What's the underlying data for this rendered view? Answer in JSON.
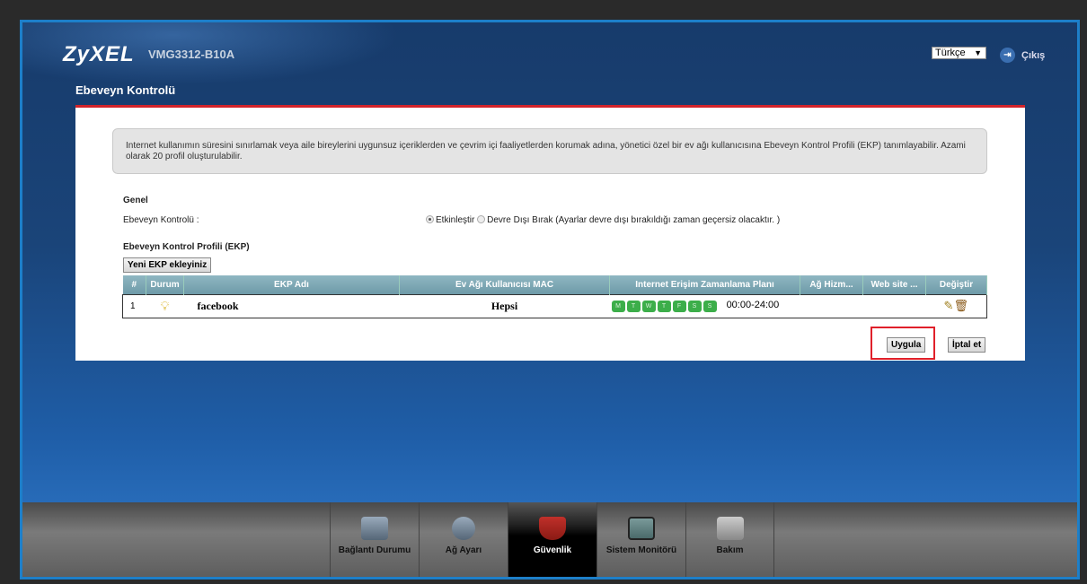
{
  "header": {
    "brand": "ZyXEL",
    "model": "VMG3312-B10A",
    "language": "Türkçe",
    "logout": "Çıkış"
  },
  "page_title": "Ebeveyn Kontrolü",
  "info": "Internet kullanımın süresini sınırlamak veya aile bireylerini uygunsuz içeriklerden ve çevrim içi faaliyetlerden korumak adına, yönetici özel bir ev ağı kullanıcısına Ebeveyn Kontrol Profili (EKP) tanımlayabilir. Azami olarak 20 profil oluşturulabilir.",
  "general": {
    "heading": "Genel",
    "label": "Ebeveyn Kontrolü :",
    "enable": "Etkinleştir",
    "disable": "Devre Dışı Bırak (Ayarlar devre dışı bırakıldığı zaman geçersiz olacaktır. )",
    "enabled": true
  },
  "profiles": {
    "heading": "Ebeveyn Kontrol Profili (EKP)",
    "add_button": "Yeni EKP ekleyiniz",
    "columns": [
      "#",
      "Durum",
      "EKP Adı",
      "Ev Ağı Kullanıcısı MAC",
      "Internet Erişim Zamanlama Planı",
      "Ağ Hizm...",
      "Web site ...",
      "Değiştir"
    ],
    "rows": [
      {
        "index": "1",
        "name": "facebook",
        "mac": "Hepsi",
        "days": [
          "M",
          "T",
          "W",
          "T",
          "F",
          "S",
          "S"
        ],
        "time": "00:00-24:00"
      }
    ]
  },
  "actions": {
    "apply": "Uygula",
    "cancel": "İptal et"
  },
  "nav": [
    {
      "label": "Bağlantı Durumu"
    },
    {
      "label": "Ağ Ayarı"
    },
    {
      "label": "Güvenlik",
      "active": true
    },
    {
      "label": "Sistem Monitörü"
    },
    {
      "label": "Bakım"
    }
  ],
  "colors": {
    "accent": "#d2232a",
    "day_on": "#3cae4a"
  }
}
